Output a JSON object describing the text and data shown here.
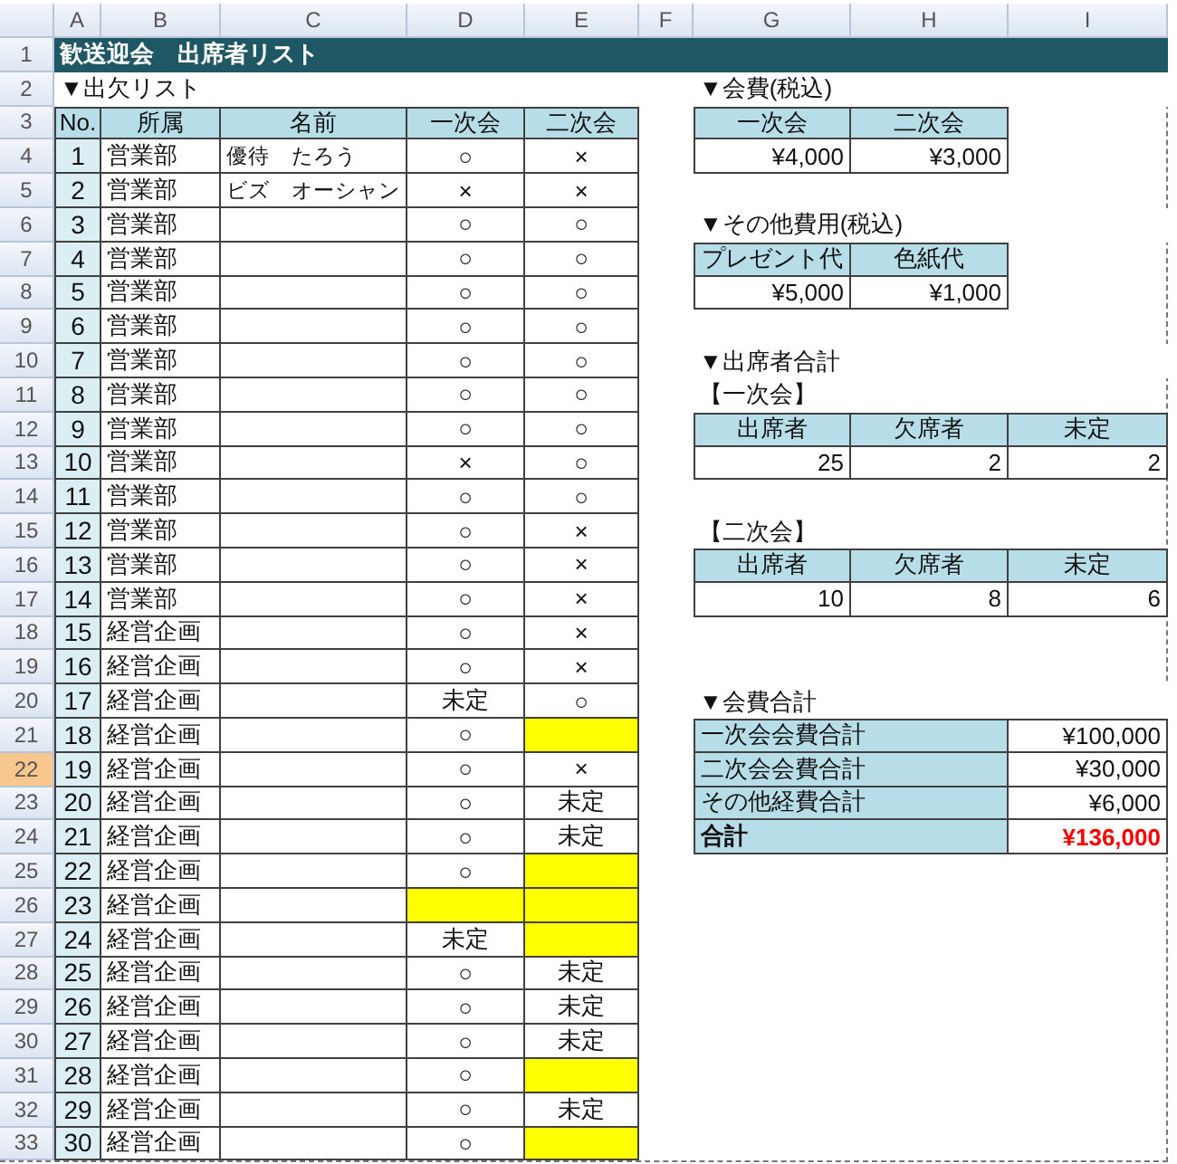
{
  "columns": [
    "A",
    "B",
    "C",
    "D",
    "E",
    "F",
    "G",
    "H",
    "I"
  ],
  "row_headers": [
    {
      "label": "1",
      "selected": false
    },
    {
      "label": "2",
      "selected": false
    },
    {
      "label": "3",
      "selected": false
    },
    {
      "label": "4",
      "selected": false
    },
    {
      "label": "5",
      "selected": false
    },
    {
      "label": "6",
      "selected": false
    },
    {
      "label": "7",
      "selected": false
    },
    {
      "label": "8",
      "selected": false
    },
    {
      "label": "9",
      "selected": false
    },
    {
      "label": "10",
      "selected": false
    },
    {
      "label": "11",
      "selected": false
    },
    {
      "label": "12",
      "selected": false
    },
    {
      "label": "13",
      "selected": false
    },
    {
      "label": "14",
      "selected": false
    },
    {
      "label": "15",
      "selected": false
    },
    {
      "label": "16",
      "selected": false
    },
    {
      "label": "17",
      "selected": false
    },
    {
      "label": "18",
      "selected": false
    },
    {
      "label": "19",
      "selected": false
    },
    {
      "label": "20",
      "selected": false
    },
    {
      "label": "21",
      "selected": false
    },
    {
      "label": "22",
      "selected": true
    },
    {
      "label": "23",
      "selected": false
    },
    {
      "label": "24",
      "selected": false
    },
    {
      "label": "25",
      "selected": false
    },
    {
      "label": "26",
      "selected": false
    },
    {
      "label": "27",
      "selected": false
    },
    {
      "label": "28",
      "selected": false
    },
    {
      "label": "29",
      "selected": false
    },
    {
      "label": "30",
      "selected": false
    },
    {
      "label": "31",
      "selected": false
    },
    {
      "label": "32",
      "selected": false
    },
    {
      "label": "33",
      "selected": false
    }
  ],
  "title": "歓送迎会　出席者リスト",
  "attendance": {
    "heading": "▼出欠リスト",
    "columns": [
      "No.",
      "所属",
      "名前",
      "一次会",
      "二次会"
    ],
    "rows": [
      {
        "no": "1",
        "dept": "営業部",
        "name": "優待　たろう",
        "first": "○",
        "second": "×",
        "first_highlighted": false,
        "second_highlighted": false
      },
      {
        "no": "2",
        "dept": "営業部",
        "name": "ビズ　オーシャン",
        "first": "×",
        "second": "×",
        "first_highlighted": false,
        "second_highlighted": false
      },
      {
        "no": "3",
        "dept": "営業部",
        "first": "○",
        "second": "○",
        "first_highlighted": false,
        "second_highlighted": false
      },
      {
        "no": "4",
        "dept": "営業部",
        "first": "○",
        "second": "○",
        "first_highlighted": false,
        "second_highlighted": false
      },
      {
        "no": "5",
        "dept": "営業部",
        "first": "○",
        "second": "○",
        "first_highlighted": false,
        "second_highlighted": false
      },
      {
        "no": "6",
        "dept": "営業部",
        "first": "○",
        "second": "○",
        "first_highlighted": false,
        "second_highlighted": false
      },
      {
        "no": "7",
        "dept": "営業部",
        "first": "○",
        "second": "○",
        "first_highlighted": false,
        "second_highlighted": false
      },
      {
        "no": "8",
        "dept": "営業部",
        "first": "○",
        "second": "○",
        "first_highlighted": false,
        "second_highlighted": false
      },
      {
        "no": "9",
        "dept": "営業部",
        "first": "○",
        "second": "○",
        "first_highlighted": false,
        "second_highlighted": false
      },
      {
        "no": "10",
        "dept": "営業部",
        "first": "×",
        "second": "○",
        "first_highlighted": false,
        "second_highlighted": false
      },
      {
        "no": "11",
        "dept": "営業部",
        "first": "○",
        "second": "○",
        "first_highlighted": false,
        "second_highlighted": false
      },
      {
        "no": "12",
        "dept": "営業部",
        "first": "○",
        "second": "×",
        "first_highlighted": false,
        "second_highlighted": false
      },
      {
        "no": "13",
        "dept": "営業部",
        "first": "○",
        "second": "×",
        "first_highlighted": false,
        "second_highlighted": false
      },
      {
        "no": "14",
        "dept": "営業部",
        "first": "○",
        "second": "×",
        "first_highlighted": false,
        "second_highlighted": false
      },
      {
        "no": "15",
        "dept": "経営企画",
        "first": "○",
        "second": "×",
        "first_highlighted": false,
        "second_highlighted": false
      },
      {
        "no": "16",
        "dept": "経営企画",
        "first": "○",
        "second": "×",
        "first_highlighted": false,
        "second_highlighted": false
      },
      {
        "no": "17",
        "dept": "経営企画",
        "first": "未定",
        "second": "○",
        "first_highlighted": false,
        "second_highlighted": false
      },
      {
        "no": "18",
        "dept": "経営企画",
        "first": "○",
        "first_highlighted": false,
        "second_highlighted": true
      },
      {
        "no": "19",
        "dept": "経営企画",
        "first": "○",
        "second": "×",
        "first_highlighted": false,
        "second_highlighted": false
      },
      {
        "no": "20",
        "dept": "経営企画",
        "first": "○",
        "second": "未定",
        "first_highlighted": false,
        "second_highlighted": false
      },
      {
        "no": "21",
        "dept": "経営企画",
        "first": "○",
        "second": "未定",
        "first_highlighted": false,
        "second_highlighted": false
      },
      {
        "no": "22",
        "dept": "経営企画",
        "first": "○",
        "first_highlighted": false,
        "second_highlighted": true
      },
      {
        "no": "23",
        "dept": "経営企画",
        "first_highlighted": true,
        "second_highlighted": true
      },
      {
        "no": "24",
        "dept": "経営企画",
        "first": "未定",
        "first_highlighted": false,
        "second_highlighted": true
      },
      {
        "no": "25",
        "dept": "経営企画",
        "first": "○",
        "second": "未定",
        "first_highlighted": false,
        "second_highlighted": false
      },
      {
        "no": "26",
        "dept": "経営企画",
        "first": "○",
        "second": "未定",
        "first_highlighted": false,
        "second_highlighted": false
      },
      {
        "no": "27",
        "dept": "経営企画",
        "first": "○",
        "second": "未定",
        "first_highlighted": false,
        "second_highlighted": false
      },
      {
        "no": "28",
        "dept": "経営企画",
        "first": "○",
        "first_highlighted": false,
        "second_highlighted": true
      },
      {
        "no": "29",
        "dept": "経営企画",
        "first": "○",
        "second": "未定",
        "first_highlighted": false,
        "second_highlighted": false
      },
      {
        "no": "30",
        "dept": "経営企画",
        "first": "○",
        "first_highlighted": false,
        "second_highlighted": true
      }
    ]
  },
  "fees": {
    "heading": "▼会費(税込)",
    "columns": [
      "一次会",
      "二次会"
    ],
    "values": [
      "¥4,000",
      "¥3,000"
    ]
  },
  "other_costs": {
    "heading": "▼その他費用(税込)",
    "columns": [
      "プレゼント代",
      "色紙代"
    ],
    "values": [
      "¥5,000",
      "¥1,000"
    ]
  },
  "attendee_totals": {
    "heading": "▼出席者合計",
    "groups": [
      {
        "label": "【一次会】",
        "columns": [
          "出席者",
          "欠席者",
          "未定"
        ],
        "values": [
          "25",
          "2",
          "2"
        ]
      },
      {
        "label": "【二次会】",
        "columns": [
          "出席者",
          "欠席者",
          "未定"
        ],
        "values": [
          "10",
          "8",
          "6"
        ]
      }
    ]
  },
  "fee_totals": {
    "heading": "▼会費合計",
    "rows": [
      {
        "label": "一次会会費合計",
        "value": "¥100,000",
        "kind": "subtotal"
      },
      {
        "label": "二次会会費合計",
        "value": "¥30,000",
        "kind": "subtotal"
      },
      {
        "label": "その他経費合計",
        "value": "¥6,000",
        "kind": "subtotal"
      },
      {
        "label": "合計",
        "value": "¥136,000",
        "kind": "total"
      }
    ]
  }
}
